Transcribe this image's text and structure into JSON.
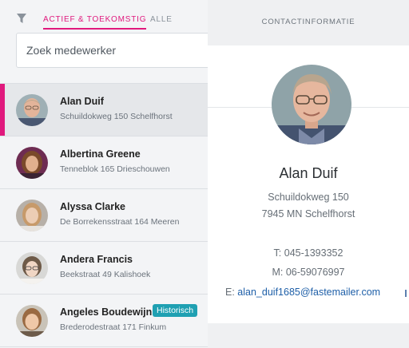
{
  "filter": {
    "icon": "filter-icon"
  },
  "tabs": [
    {
      "label": "ACTIEF & TOEKOMSTIG",
      "active": true
    },
    {
      "label": "ALLE",
      "active": false
    }
  ],
  "search": {
    "placeholder": "Zoek medewerker",
    "value": ""
  },
  "employees": [
    {
      "name": "Alan Duif",
      "address": "Schuildokweg 150 Schelfhorst",
      "selected": true,
      "badge": ""
    },
    {
      "name": "Albertina Greene",
      "address": "Tenneblok 165 Drieschouwen",
      "selected": false,
      "badge": ""
    },
    {
      "name": "Alyssa Clarke",
      "address": "De Borrekensstraat 164 Meeren",
      "selected": false,
      "badge": ""
    },
    {
      "name": "Andera Francis",
      "address": "Beekstraat 49 Kalishoek",
      "selected": false,
      "badge": ""
    },
    {
      "name": "Angeles Boudewijn",
      "address": "Brederodestraat 171 Finkum",
      "selected": false,
      "badge": "Historisch"
    }
  ],
  "detail": {
    "header": "CONTACTINFORMATIE",
    "name": "Alan Duif",
    "street": "Schuildokweg 150",
    "city": "7945 MN Schelfhorst",
    "phone": "T: 045-1393352",
    "mobile": "M: 06-59076997",
    "email_prefix": "E: ",
    "email": "alan_duif1685@fastemailer.com"
  },
  "colors": {
    "accent": "#e0197d",
    "badge": "#1fa0b2",
    "link": "#1e5fa8"
  }
}
